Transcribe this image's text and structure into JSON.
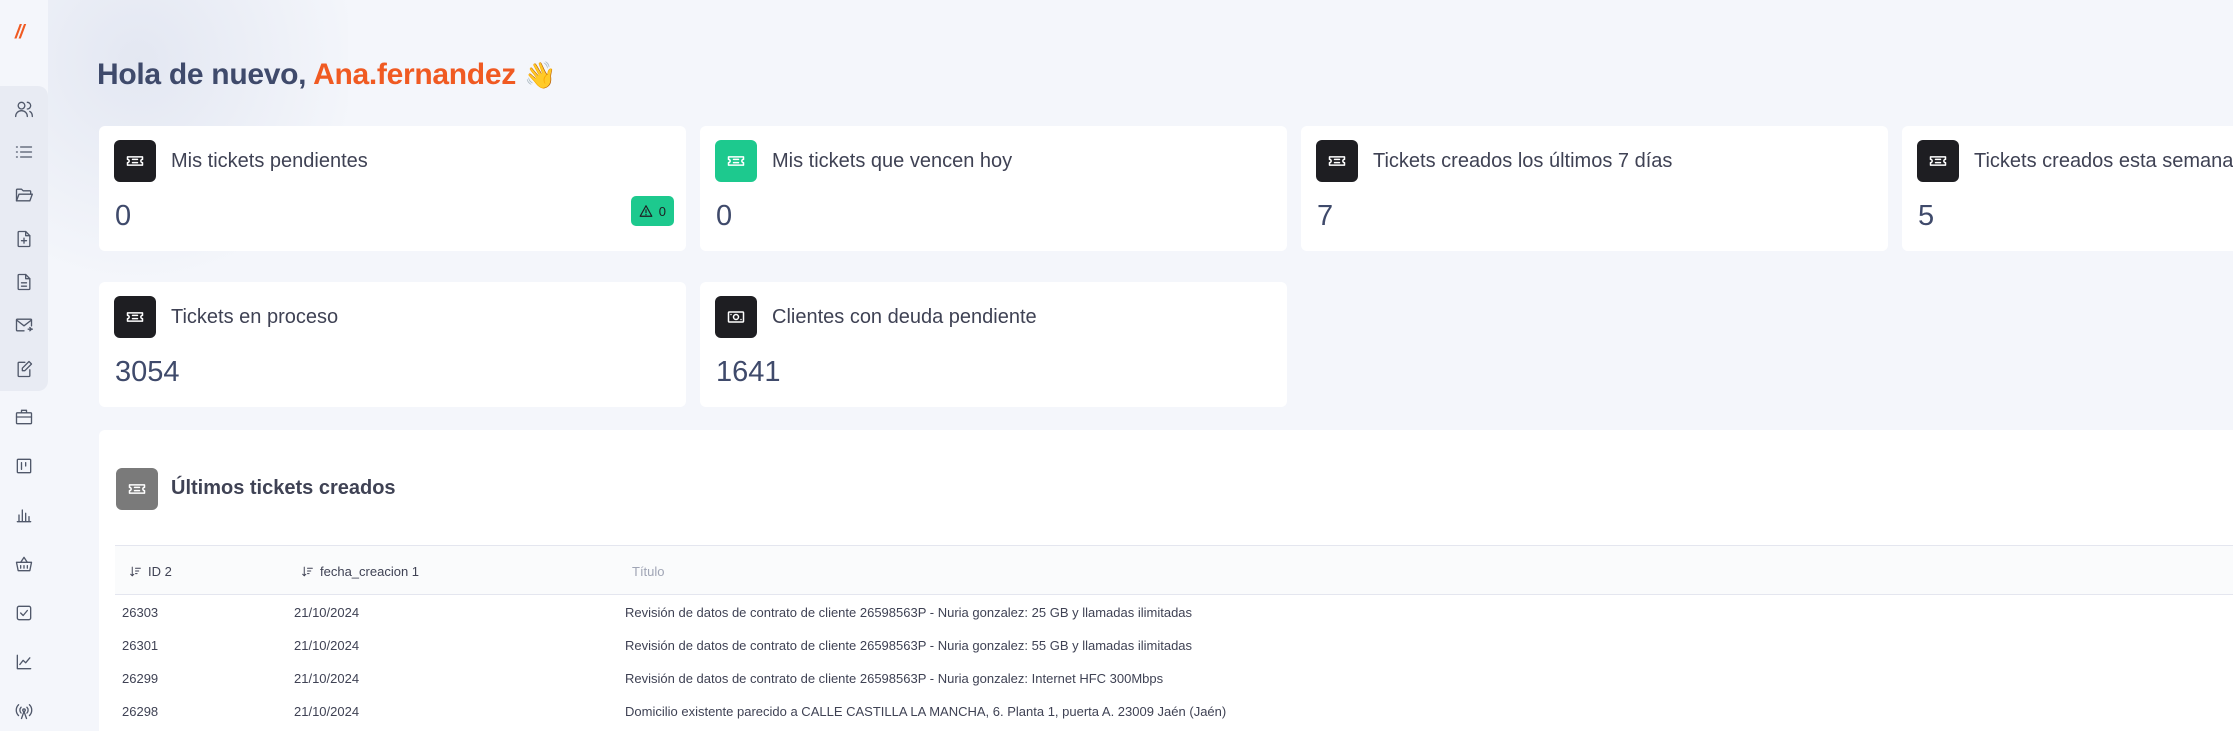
{
  "logo": "//",
  "sidebar": {
    "items": [
      {
        "icon": "users-icon"
      },
      {
        "icon": "list-icon"
      },
      {
        "icon": "folder-open-icon"
      },
      {
        "icon": "file-plus-icon"
      },
      {
        "icon": "file-text-icon"
      },
      {
        "icon": "mail-send-icon"
      },
      {
        "icon": "edit-document-icon"
      },
      {
        "icon": "briefcase-icon"
      },
      {
        "icon": "kanban-icon"
      },
      {
        "icon": "bar-chart-icon"
      },
      {
        "icon": "basket-icon"
      },
      {
        "icon": "checkbox-icon"
      },
      {
        "icon": "line-chart-icon"
      },
      {
        "icon": "antenna-icon"
      }
    ]
  },
  "header": {
    "greeting_prefix": "Hola de nuevo,",
    "username": "Ana.fernandez",
    "emoji": "👋"
  },
  "cards": {
    "pending": {
      "title": "Mis tickets pendientes",
      "value": "0",
      "badge": "0"
    },
    "due_today": {
      "title": "Mis tickets que vencen hoy",
      "value": "0"
    },
    "last7": {
      "title": "Tickets creados los últimos 7 días",
      "value": "7"
    },
    "this_week": {
      "title": "Tickets creados esta semana",
      "value": "5"
    },
    "in_process": {
      "title": "Tickets en proceso",
      "value": "3054"
    },
    "debt": {
      "title": "Clientes con deuda pendiente",
      "value": "1641"
    }
  },
  "colors": {
    "accent": "#f05a22",
    "green": "#1dc98e",
    "dark_icon": "#1e1e22"
  },
  "table": {
    "title": "Últimos tickets creados",
    "columns": [
      "ID 2",
      "fecha_creacion 1",
      "Título"
    ],
    "rows": [
      {
        "id": "26303",
        "date": "21/10/2024",
        "title": "Revisión de datos de contrato de cliente 26598563P - Nuria gonzalez: 25 GB y llamadas ilimitadas"
      },
      {
        "id": "26301",
        "date": "21/10/2024",
        "title": "Revisión de datos de contrato de cliente 26598563P - Nuria gonzalez: 55 GB y llamadas ilimitadas"
      },
      {
        "id": "26299",
        "date": "21/10/2024",
        "title": "Revisión de datos de contrato de cliente 26598563P - Nuria gonzalez: Internet HFC 300Mbps"
      },
      {
        "id": "26298",
        "date": "21/10/2024",
        "title": "Domicilio existente parecido a CALLE CASTILLA LA MANCHA, 6. Planta 1, puerta A. 23009 Jaén (Jaén)"
      }
    ]
  }
}
